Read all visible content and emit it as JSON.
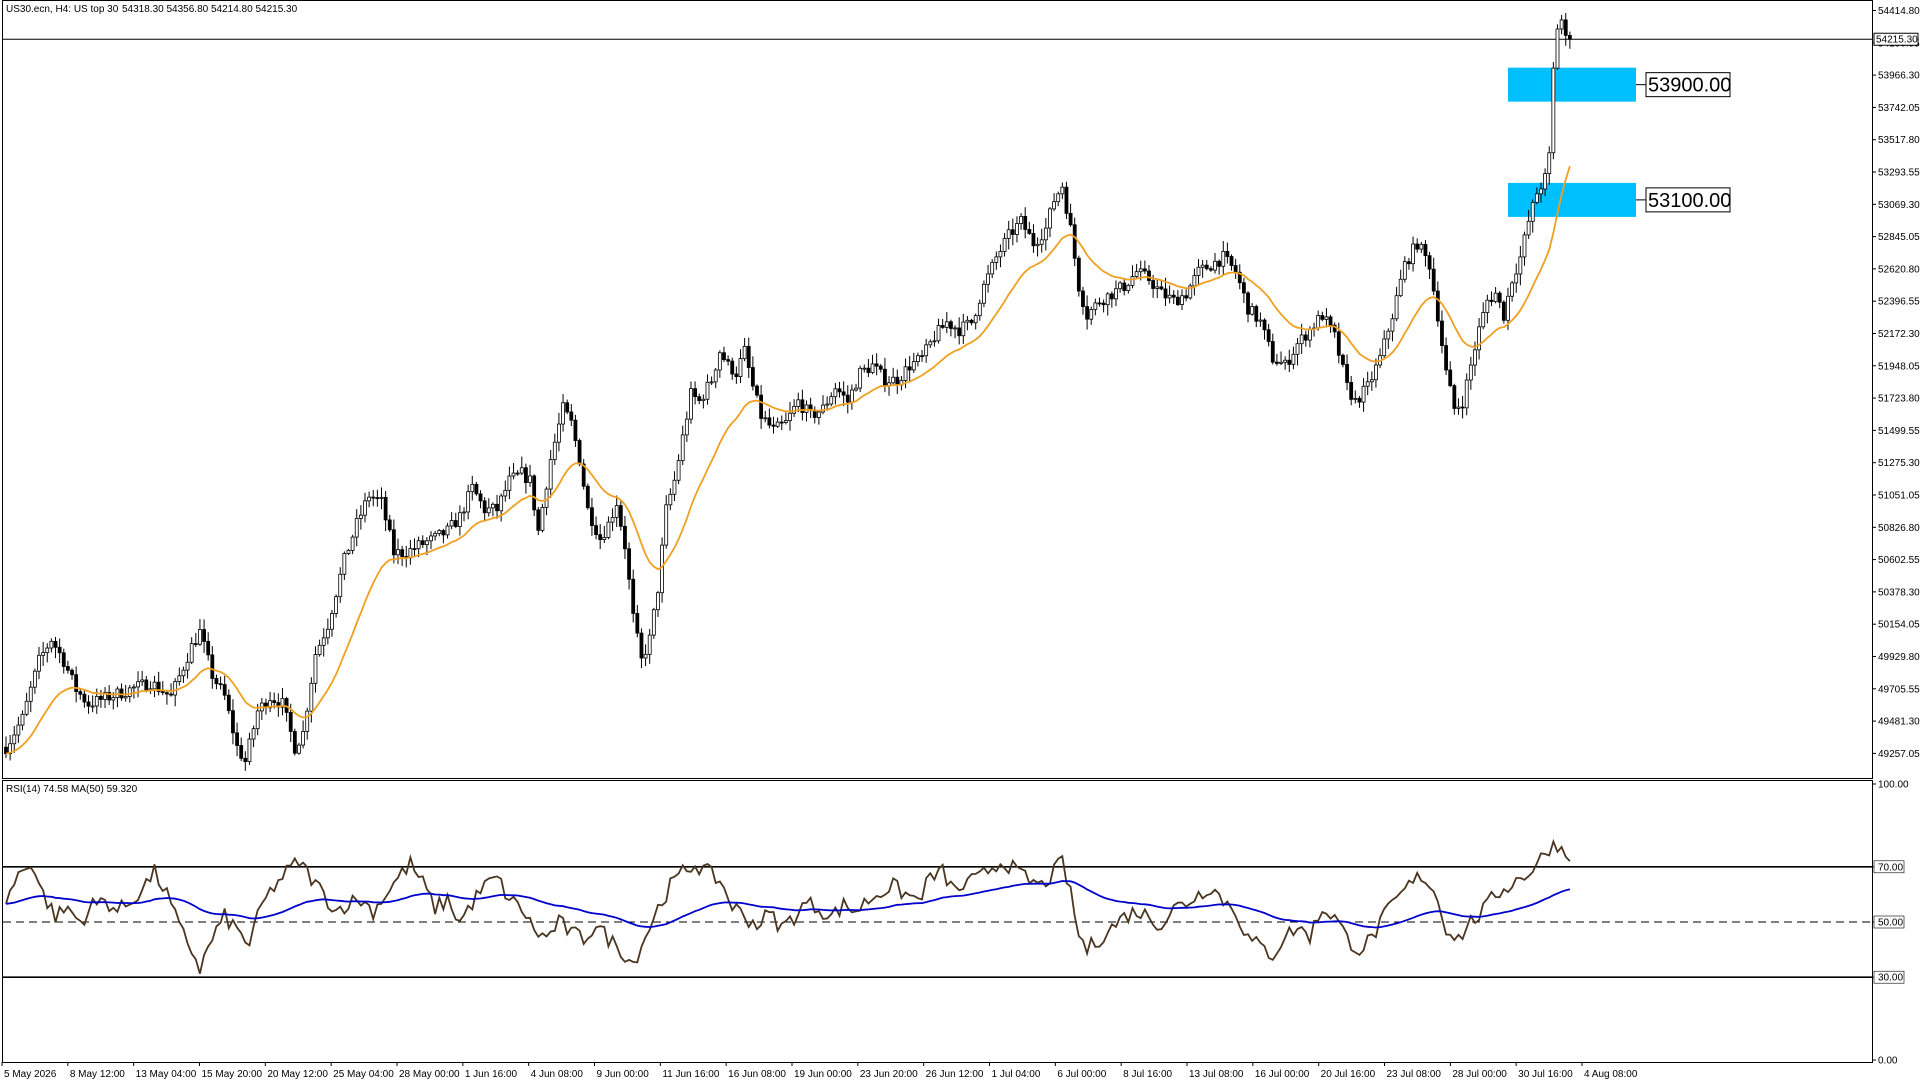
{
  "header": {
    "symbol_info": "US30.ecn, H4:  US top 30",
    "ohlc": "54318.30 54356.80 54214.80 54215.30"
  },
  "price_axis": {
    "ticks": [
      "54414.80",
      "54190.55",
      "53966.30",
      "53742.05",
      "53517.80",
      "53293.55",
      "53069.30",
      "52845.05",
      "52620.80",
      "52396.55",
      "52172.30",
      "51948.05",
      "51723.80",
      "51499.55",
      "51275.30",
      "51051.05",
      "50826.80",
      "50602.55",
      "50378.30",
      "50154.05",
      "49929.80",
      "49705.55",
      "49481.30",
      "49257.05"
    ],
    "current_price_label": "54215.30"
  },
  "time_axis": {
    "ticks": [
      "5 May 2026",
      "8 May 12:00",
      "13 May 04:00",
      "15 May 20:00",
      "20 May 12:00",
      "25 May 04:00",
      "28 May 00:00",
      "1 Jun 16:00",
      "4 Jun 08:00",
      "9 Jun 00:00",
      "11 Jun 16:00",
      "16 Jun 08:00",
      "19 Jun 00:00",
      "23 Jun 20:00",
      "26 Jun 12:00",
      "1 Jul 04:00",
      "6 Jul 00:00",
      "8 Jul 16:00",
      "13 Jul 08:00",
      "16 Jul 00:00",
      "20 Jul 16:00",
      "23 Jul 08:00",
      "28 Jul 00:00",
      "30 Jul 16:00",
      "4 Aug 08:00"
    ]
  },
  "rsi_panel": {
    "label": "RSI(14) 74.58 MA(50) 59.320",
    "ticks": [
      "100.00",
      "70.00",
      "50.00",
      "30.00",
      "0.00"
    ]
  },
  "levels": [
    {
      "label": "53900.00",
      "value": 53900,
      "color": "#00BFFF"
    },
    {
      "label": "53100.00",
      "value": 53100,
      "color": "#00BFFF"
    }
  ],
  "colors": {
    "bull": "#000000",
    "bear": "#000000",
    "ma": "#F0A020",
    "rsi": "#4A3520",
    "rsi_ma": "#0000CC",
    "zone": "#00BFFF"
  },
  "chart_data": {
    "type": "candlestick",
    "symbol": "US30.ecn",
    "timeframe": "H4",
    "ylim": [
      49100,
      54460
    ],
    "current_price": 54215.3,
    "price_path": [
      [
        0,
        49300
      ],
      [
        4,
        49500
      ],
      [
        8,
        49900
      ],
      [
        11,
        50050
      ],
      [
        14,
        49900
      ],
      [
        17,
        49700
      ],
      [
        20,
        49600
      ],
      [
        25,
        49650
      ],
      [
        30,
        49700
      ],
      [
        35,
        49750
      ],
      [
        40,
        49650
      ],
      [
        45,
        50000
      ],
      [
        47,
        50100
      ],
      [
        50,
        49800
      ],
      [
        53,
        49650
      ],
      [
        56,
        49300
      ],
      [
        58,
        49200
      ],
      [
        61,
        49550
      ],
      [
        64,
        49650
      ],
      [
        67,
        49600
      ],
      [
        70,
        49300
      ],
      [
        72,
        49400
      ],
      [
        75,
        49950
      ],
      [
        78,
        50150
      ],
      [
        82,
        50600
      ],
      [
        85,
        50850
      ],
      [
        88,
        51050
      ],
      [
        91,
        51000
      ],
      [
        94,
        50650
      ],
      [
        97,
        50650
      ],
      [
        100,
        50700
      ],
      [
        104,
        50750
      ],
      [
        107,
        50800
      ],
      [
        110,
        50900
      ],
      [
        113,
        51100
      ],
      [
        116,
        50950
      ],
      [
        119,
        50950
      ],
      [
        122,
        51150
      ],
      [
        125,
        51200
      ],
      [
        127,
        51150
      ],
      [
        129,
        50800
      ],
      [
        132,
        51300
      ],
      [
        135,
        51650
      ],
      [
        137,
        51550
      ],
      [
        139,
        51300
      ],
      [
        141,
        50950
      ],
      [
        144,
        50750
      ],
      [
        146,
        50850
      ],
      [
        148,
        51000
      ],
      [
        150,
        50700
      ],
      [
        152,
        50200
      ],
      [
        154,
        49900
      ],
      [
        156,
        50050
      ],
      [
        158,
        50400
      ],
      [
        160,
        50950
      ],
      [
        162,
        51150
      ],
      [
        164,
        51450
      ],
      [
        166,
        51750
      ],
      [
        168,
        51700
      ],
      [
        171,
        51850
      ],
      [
        173,
        52050
      ],
      [
        175,
        51950
      ],
      [
        177,
        51900
      ],
      [
        179,
        52050
      ],
      [
        181,
        51800
      ],
      [
        183,
        51600
      ],
      [
        186,
        51500
      ],
      [
        189,
        51550
      ],
      [
        192,
        51700
      ],
      [
        195,
        51600
      ],
      [
        198,
        51650
      ],
      [
        201,
        51800
      ],
      [
        204,
        51700
      ],
      [
        207,
        51900
      ],
      [
        210,
        51950
      ],
      [
        213,
        51850
      ],
      [
        216,
        51850
      ],
      [
        219,
        51950
      ],
      [
        222,
        52000
      ],
      [
        225,
        52150
      ],
      [
        228,
        52250
      ],
      [
        231,
        52200
      ],
      [
        234,
        52250
      ],
      [
        237,
        52500
      ],
      [
        240,
        52700
      ],
      [
        243,
        52850
      ],
      [
        246,
        52950
      ],
      [
        249,
        52800
      ],
      [
        252,
        52900
      ],
      [
        254,
        53100
      ],
      [
        256,
        53200
      ],
      [
        258,
        52900
      ],
      [
        260,
        52500
      ],
      [
        262,
        52300
      ],
      [
        265,
        52400
      ],
      [
        268,
        52450
      ],
      [
        271,
        52500
      ],
      [
        274,
        52600
      ],
      [
        277,
        52550
      ],
      [
        280,
        52450
      ],
      [
        283,
        52400
      ],
      [
        286,
        52450
      ],
      [
        289,
        52600
      ],
      [
        292,
        52650
      ],
      [
        295,
        52700
      ],
      [
        298,
        52600
      ],
      [
        301,
        52350
      ],
      [
        304,
        52250
      ],
      [
        307,
        52000
      ],
      [
        310,
        51950
      ],
      [
        313,
        52100
      ],
      [
        316,
        52200
      ],
      [
        319,
        52300
      ],
      [
        322,
        52150
      ],
      [
        325,
        51800
      ],
      [
        327,
        51700
      ],
      [
        330,
        51800
      ],
      [
        333,
        52000
      ],
      [
        336,
        52300
      ],
      [
        339,
        52650
      ],
      [
        342,
        52800
      ],
      [
        345,
        52650
      ],
      [
        347,
        52300
      ],
      [
        349,
        51900
      ],
      [
        351,
        51650
      ],
      [
        353,
        51700
      ],
      [
        355,
        51950
      ],
      [
        357,
        52200
      ],
      [
        359,
        52400
      ],
      [
        361,
        52450
      ],
      [
        363,
        52300
      ],
      [
        365,
        52550
      ],
      [
        367,
        52700
      ],
      [
        369,
        52950
      ],
      [
        371,
        53150
      ],
      [
        373,
        53250
      ],
      [
        374,
        53400
      ],
      [
        375,
        54000
      ],
      [
        376,
        54300
      ],
      [
        377,
        54350
      ],
      [
        378,
        54215
      ]
    ],
    "rsi_path": [
      [
        0,
        58
      ],
      [
        3,
        67
      ],
      [
        6,
        72
      ],
      [
        9,
        60
      ],
      [
        12,
        52
      ],
      [
        15,
        55
      ],
      [
        18,
        50
      ],
      [
        21,
        56
      ],
      [
        24,
        58
      ],
      [
        27,
        54
      ],
      [
        30,
        57
      ],
      [
        33,
        62
      ],
      [
        36,
        68
      ],
      [
        39,
        60
      ],
      [
        42,
        48
      ],
      [
        45,
        40
      ],
      [
        47,
        33
      ],
      [
        50,
        44
      ],
      [
        53,
        52
      ],
      [
        56,
        47
      ],
      [
        59,
        42
      ],
      [
        62,
        56
      ],
      [
        65,
        63
      ],
      [
        68,
        68
      ],
      [
        71,
        72
      ],
      [
        74,
        66
      ],
      [
        77,
        60
      ],
      [
        80,
        54
      ],
      [
        83,
        57
      ],
      [
        86,
        58
      ],
      [
        89,
        54
      ],
      [
        92,
        60
      ],
      [
        95,
        66
      ],
      [
        98,
        71
      ],
      [
        101,
        64
      ],
      [
        104,
        55
      ],
      [
        107,
        58
      ],
      [
        110,
        50
      ],
      [
        113,
        57
      ],
      [
        116,
        63
      ],
      [
        119,
        66
      ],
      [
        122,
        58
      ],
      [
        125,
        55
      ],
      [
        128,
        47
      ],
      [
        131,
        44
      ],
      [
        134,
        50
      ],
      [
        137,
        46
      ],
      [
        140,
        44
      ],
      [
        143,
        49
      ],
      [
        146,
        44
      ],
      [
        149,
        40
      ],
      [
        152,
        35
      ],
      [
        155,
        45
      ],
      [
        158,
        55
      ],
      [
        161,
        63
      ],
      [
        164,
        68
      ],
      [
        167,
        71
      ],
      [
        170,
        68
      ],
      [
        173,
        65
      ],
      [
        176,
        56
      ],
      [
        179,
        52
      ],
      [
        182,
        49
      ],
      [
        185,
        53
      ],
      [
        188,
        48
      ],
      [
        191,
        52
      ],
      [
        194,
        57
      ],
      [
        197,
        55
      ],
      [
        200,
        52
      ],
      [
        203,
        56
      ],
      [
        206,
        54
      ],
      [
        209,
        58
      ],
      [
        212,
        61
      ],
      [
        215,
        63
      ],
      [
        218,
        60
      ],
      [
        221,
        58
      ],
      [
        224,
        66
      ],
      [
        227,
        68
      ],
      [
        230,
        61
      ],
      [
        233,
        64
      ],
      [
        236,
        66
      ],
      [
        239,
        70
      ],
      [
        242,
        72
      ],
      [
        245,
        68
      ],
      [
        248,
        65
      ],
      [
        251,
        63
      ],
      [
        254,
        68
      ],
      [
        256,
        72
      ],
      [
        258,
        60
      ],
      [
        260,
        45
      ],
      [
        262,
        40
      ],
      [
        265,
        44
      ],
      [
        268,
        48
      ],
      [
        271,
        52
      ],
      [
        274,
        54
      ],
      [
        277,
        52
      ],
      [
        280,
        49
      ],
      [
        283,
        55
      ],
      [
        286,
        57
      ],
      [
        289,
        60
      ],
      [
        292,
        63
      ],
      [
        295,
        58
      ],
      [
        298,
        54
      ],
      [
        301,
        44
      ],
      [
        304,
        41
      ],
      [
        307,
        38
      ],
      [
        310,
        45
      ],
      [
        313,
        48
      ],
      [
        316,
        45
      ],
      [
        319,
        55
      ],
      [
        322,
        52
      ],
      [
        325,
        44
      ],
      [
        328,
        40
      ],
      [
        331,
        44
      ],
      [
        334,
        52
      ],
      [
        337,
        58
      ],
      [
        340,
        63
      ],
      [
        343,
        67
      ],
      [
        346,
        62
      ],
      [
        349,
        48
      ],
      [
        352,
        44
      ],
      [
        355,
        50
      ],
      [
        358,
        54
      ],
      [
        361,
        60
      ],
      [
        364,
        63
      ],
      [
        367,
        66
      ],
      [
        370,
        69
      ],
      [
        372,
        73
      ],
      [
        374,
        77
      ],
      [
        376,
        78
      ],
      [
        378,
        75
      ]
    ]
  }
}
